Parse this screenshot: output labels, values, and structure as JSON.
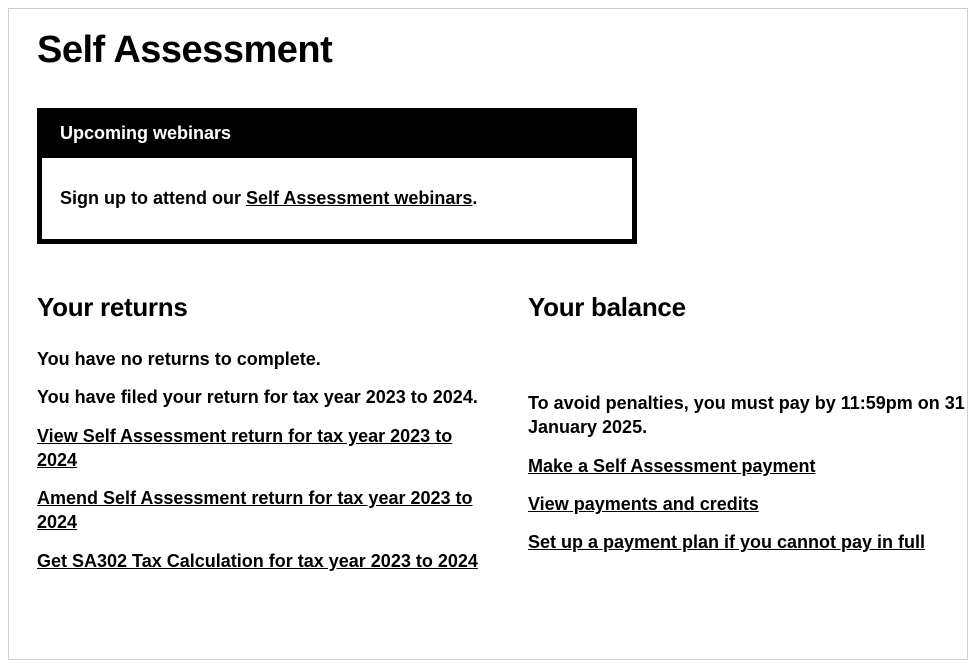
{
  "pageTitle": "Self Assessment",
  "webinar": {
    "header": "Upcoming webinars",
    "bodyPrefix": "Sign up to attend our ",
    "linkText": "Self Assessment webinars",
    "bodySuffix": "."
  },
  "returns": {
    "heading": "Your returns",
    "noReturns": "You have no returns to complete.",
    "filedNotice": "You have filed your return for tax year 2023 to 2024.",
    "links": [
      "View Self Assessment return for tax year 2023 to 2024",
      "Amend Self Assessment return for tax year 2023 to 2024",
      "Get SA302 Tax Calculation for tax year 2023 to 2024"
    ]
  },
  "balance": {
    "heading": "Your balance",
    "notice": "To avoid penalties, you must pay by 11:59pm on 31 January 2025.",
    "links": [
      "Make a Self Assessment payment",
      "View payments and credits",
      "Set up a payment plan if you cannot pay in full"
    ]
  }
}
